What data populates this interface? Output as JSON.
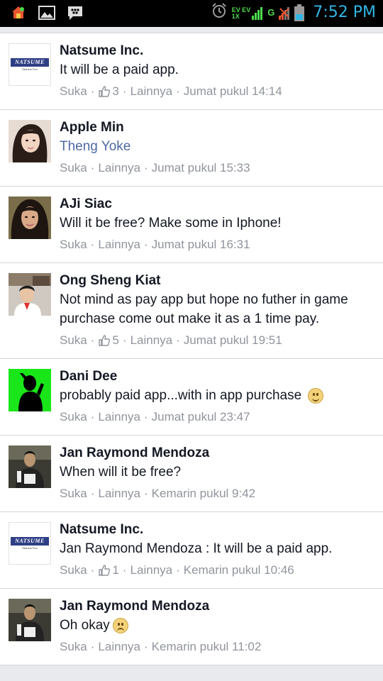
{
  "status_bar": {
    "time": "7:52 PM",
    "network_label": "G",
    "ev_top": "EV EV",
    "ev_bottom": "1X",
    "icons": [
      "home-notification-icon",
      "image-icon",
      "bbm-icon",
      "alarm-icon",
      "signal-icon",
      "battery-icon"
    ]
  },
  "colors": {
    "author": "#141823",
    "link": "#4e69a2",
    "meta": "#90949c",
    "time": "#33b5e5"
  },
  "comments": [
    {
      "author": "Natsume Inc.",
      "text": "It will be a paid app.",
      "like": "Suka",
      "likes": "3",
      "more": "Lainnya",
      "time": "Jumat pukul 14:14",
      "avatar_logo": "NATSUME",
      "avatar_sub": "Serious Fun"
    },
    {
      "author": "Apple Min",
      "text": "Theng Yoke",
      "like": "Suka",
      "more": "Lainnya",
      "time": "Jumat pukul 15:33"
    },
    {
      "author": "AJi Siac",
      "text": "Will it be free? Make some in Iphone!",
      "like": "Suka",
      "more": "Lainnya",
      "time": "Jumat pukul 16:31"
    },
    {
      "author": "Ong Sheng Kiat",
      "text": "Not mind as pay app but hope no futher in game purchase come out make it as a 1 time pay.",
      "like": "Suka",
      "likes": "5",
      "more": "Lainnya",
      "time": "Jumat pukul 19:51"
    },
    {
      "author": "Dani Dee",
      "text": "probably paid app...with in app purchase",
      "like": "Suka",
      "more": "Lainnya",
      "time": "Jumat pukul 23:47"
    },
    {
      "author": "Jan Raymond Mendoza",
      "text": "When will it be free?",
      "like": "Suka",
      "more": "Lainnya",
      "time": "Kemarin pukul 9:42"
    },
    {
      "author": "Natsume Inc.",
      "text": "Jan Raymond Mendoza : It will be a paid app.",
      "like": "Suka",
      "likes": "1",
      "more": "Lainnya",
      "time": "Kemarin pukul 10:46",
      "avatar_logo": "NATSUME",
      "avatar_sub": "Serious Fun"
    },
    {
      "author": "Jan Raymond Mendoza",
      "text": "Oh okay",
      "like": "Suka",
      "more": "Lainnya",
      "time": "Kemarin pukul 11:02"
    }
  ]
}
